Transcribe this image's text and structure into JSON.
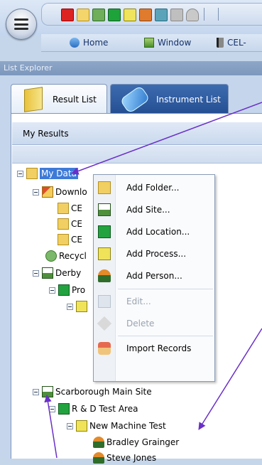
{
  "ribbon": {
    "tabs": [
      "Home",
      "Window",
      "CEL-"
    ]
  },
  "panel": {
    "title": "List Explorer",
    "tabs": [
      "Result List",
      "Instrument List"
    ],
    "results_header": "My Results"
  },
  "tree": {
    "my_data": "My Data",
    "downloads": "Downlo",
    "ce1": "CE",
    "ce2": "CE",
    "ce3": "CE",
    "recycle": "Recycl",
    "derby": "Derby",
    "pro": "Pro",
    "scarborough": "Scarborough Main Site",
    "rd": "R & D Test Area",
    "machine_test": "New Machine Test",
    "person1": "Bradley Grainger",
    "person2": "Steve Jones"
  },
  "context_menu": {
    "items": [
      "Add Folder...",
      "Add Site...",
      "Add Location...",
      "Add Process...",
      "Add Person...",
      "Edit...",
      "Delete",
      "Import Records"
    ]
  },
  "colors": {
    "selection": "#3d7ad8",
    "arrow": "#6a2fc8",
    "panel_title_bg": "#7c97bd"
  }
}
